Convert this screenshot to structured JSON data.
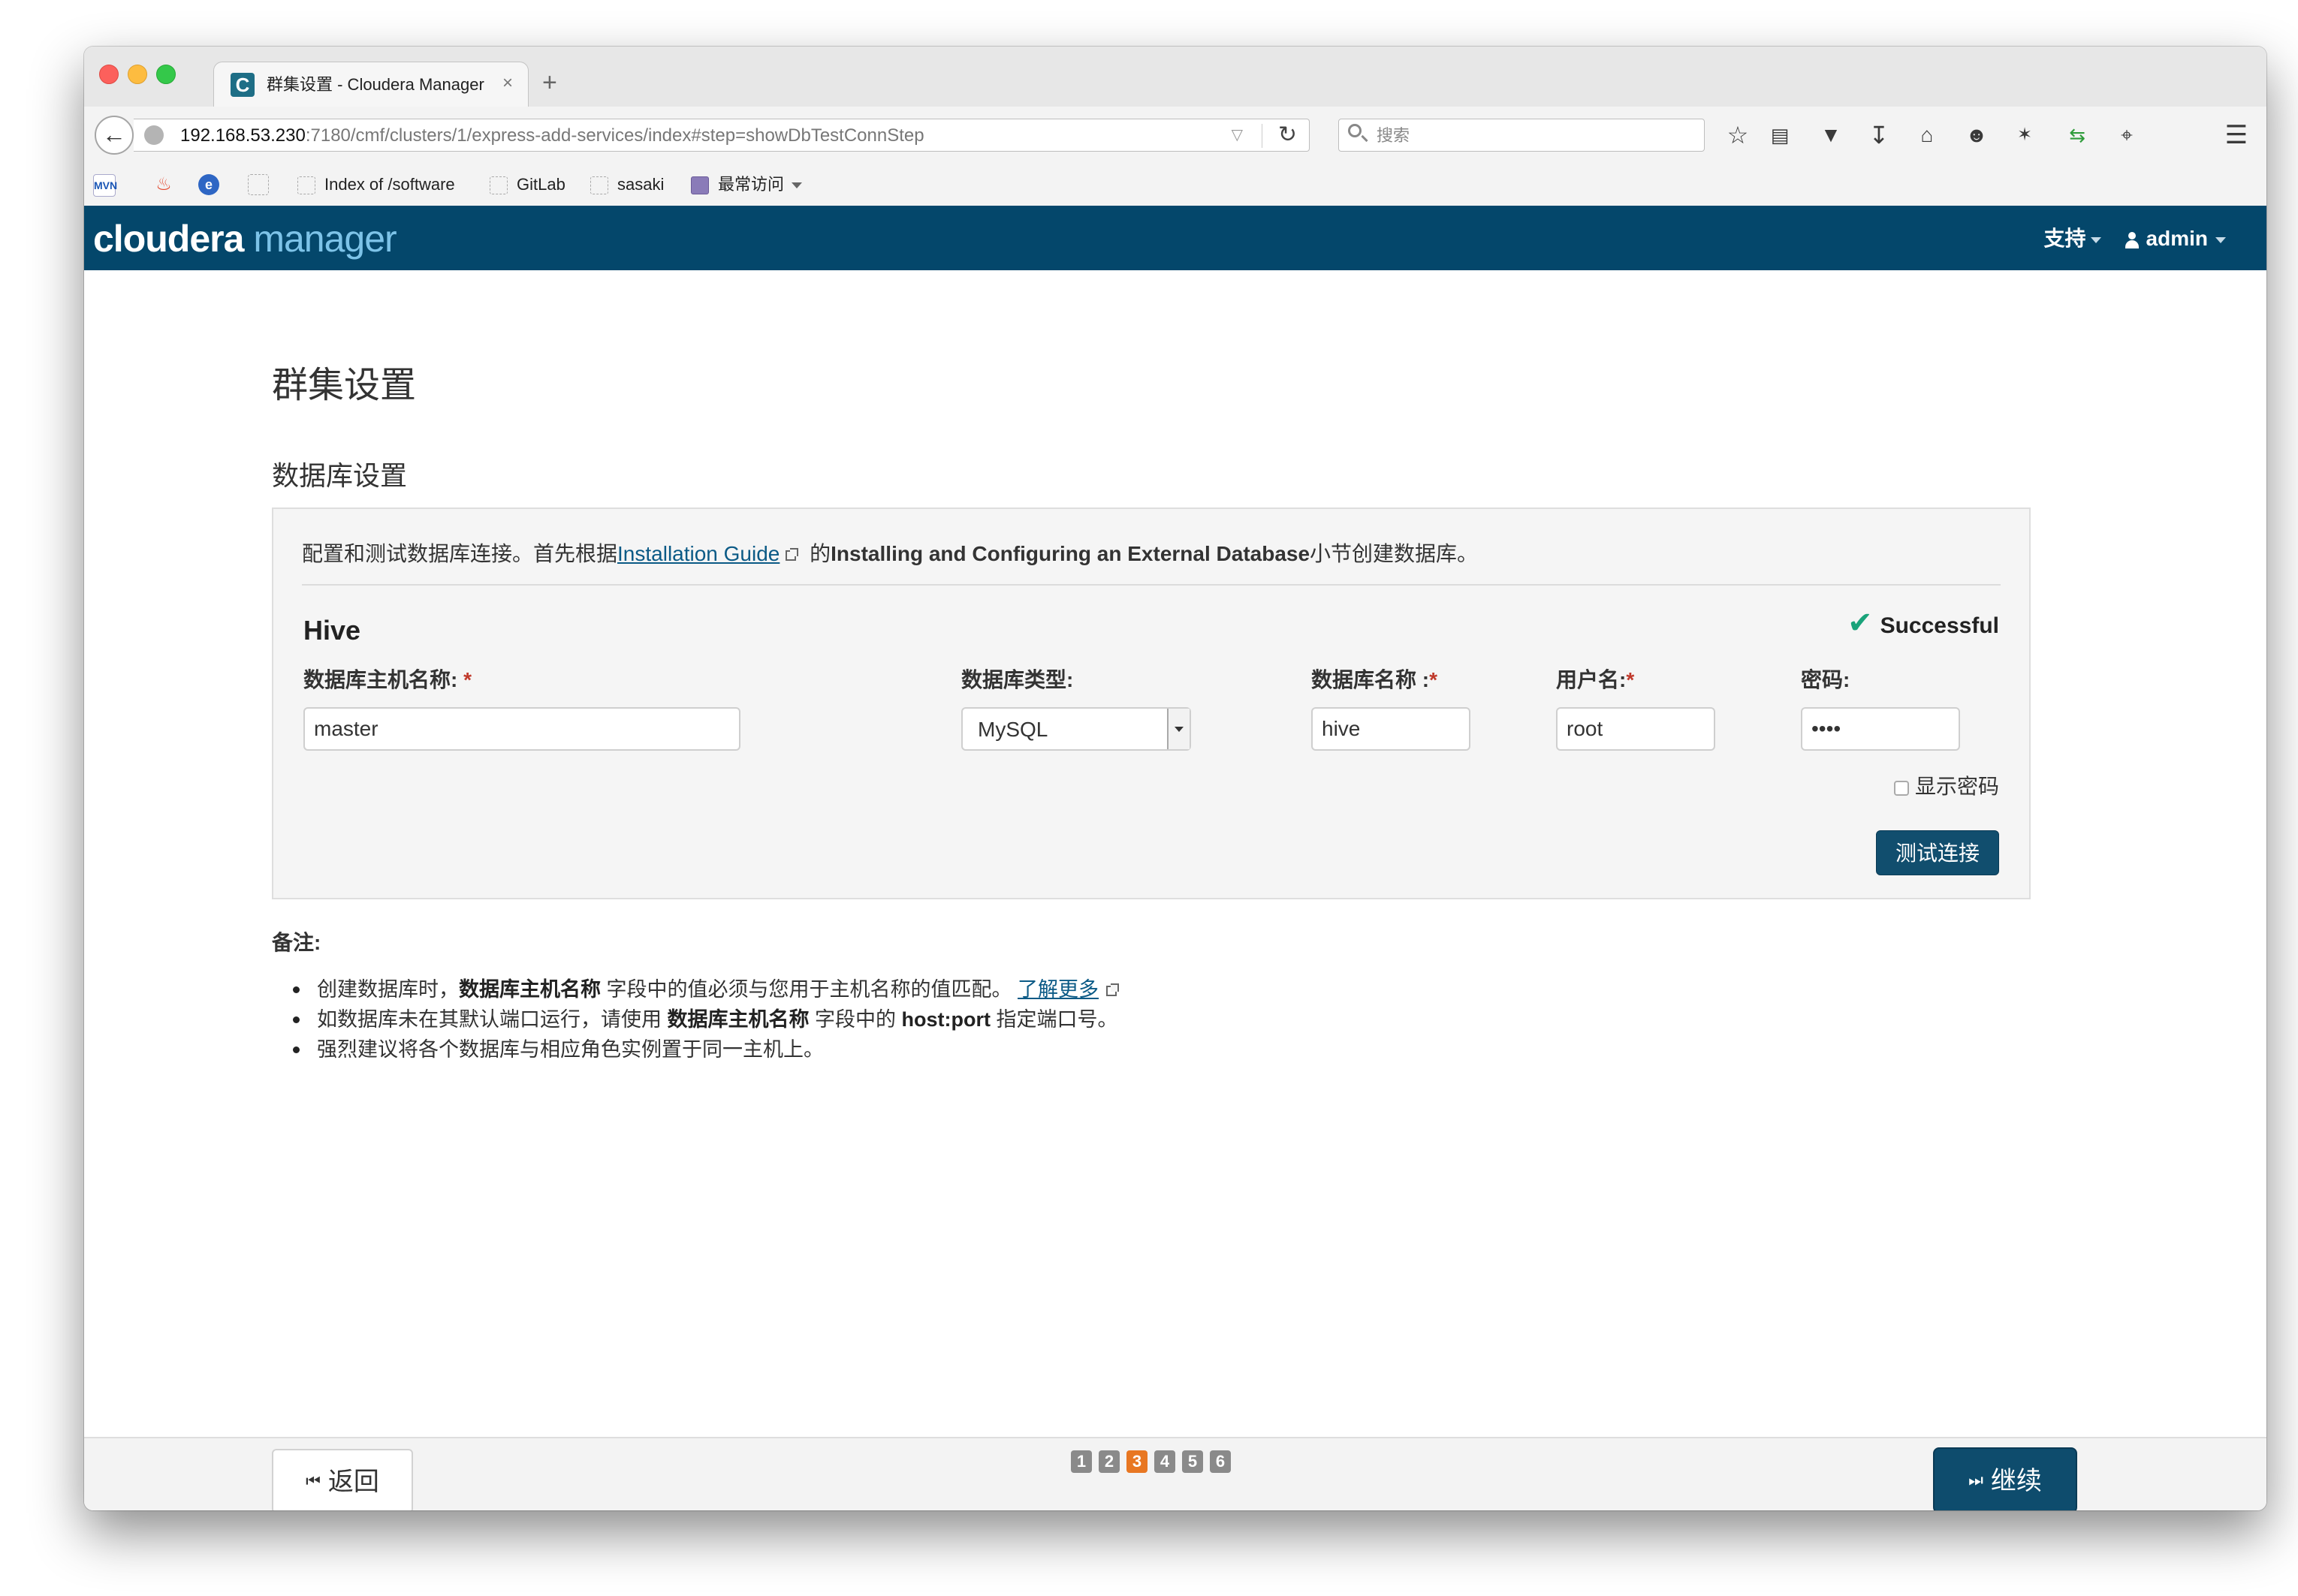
{
  "browser": {
    "tab_title": "群集设置 - Cloudera Manager",
    "tab_favicon": "C",
    "tab_close": "×",
    "new_tab": "+",
    "url_host": "192.168.53.230",
    "url_rest": ":7180/cmf/clusters/1/express-add-services/index#step=showDbTestConnStep",
    "search_placeholder": "搜索",
    "toolbar_icons": [
      "star-icon",
      "reading-list-icon",
      "pocket-icon",
      "download-icon",
      "home-icon",
      "chat-icon",
      "addon-icon",
      "sync-icon",
      "crop-icon",
      "menu-icon"
    ],
    "bookmarks": [
      {
        "icon": "maven-icon",
        "label": ""
      },
      {
        "icon": "flame-icon",
        "label": ""
      },
      {
        "icon": "edge-icon",
        "label": ""
      },
      {
        "icon": "blank-icon",
        "label": ""
      },
      {
        "icon": "folder-icon",
        "label": "Index of /software"
      },
      {
        "icon": "folder-icon",
        "label": "GitLab"
      },
      {
        "icon": "folder-icon",
        "label": "sasaki"
      },
      {
        "icon": "gear-folder-icon",
        "label": "最常访问"
      }
    ]
  },
  "header": {
    "logo_a": "cloudera",
    "logo_b": "manager",
    "support": "支持",
    "user": "admin",
    "bg": "#04476b"
  },
  "page": {
    "title": "群集设置",
    "section_title": "数据库设置",
    "intro_prefix": "配置和测试数据库连接。首先根据",
    "intro_link": "Installation Guide",
    "intro_mid": " 的",
    "intro_bold": "Installing and Configuring an External Database",
    "intro_suffix": "小节创建数据库。"
  },
  "service": {
    "name": "Hive",
    "status": "Successful",
    "fields": {
      "host_label": "数据库主机名称:",
      "host_value": "master",
      "type_label": "数据库类型:",
      "type_value": "MySQL",
      "dbname_label": "数据库名称 :",
      "dbname_value": "hive",
      "user_label": "用户名:",
      "user_value": "root",
      "password_label": "密码:",
      "password_value": "••••"
    },
    "show_password": "显示密码",
    "test_button": "测试连接"
  },
  "notes": {
    "title": "备注:",
    "items": [
      {
        "pre": "创建数据库时，",
        "bold": "数据库主机名称",
        "post": " 字段中的值必须与您用于主机名称的值匹配。 ",
        "link": "了解更多"
      },
      {
        "pre": "如数据库未在其默认端口运行，请使用 ",
        "bold": "数据库主机名称",
        "mid": " 字段中的 ",
        "bold2": "host:port",
        "post": " 指定端口号。"
      },
      {
        "text": "强烈建议将各个数据库与相应角色实例置于同一主机上。"
      }
    ]
  },
  "footer": {
    "back": "返回",
    "next": "继续",
    "steps": [
      "1",
      "2",
      "3",
      "4",
      "5",
      "6"
    ],
    "active_step": "3",
    "accent": "#e87722"
  }
}
